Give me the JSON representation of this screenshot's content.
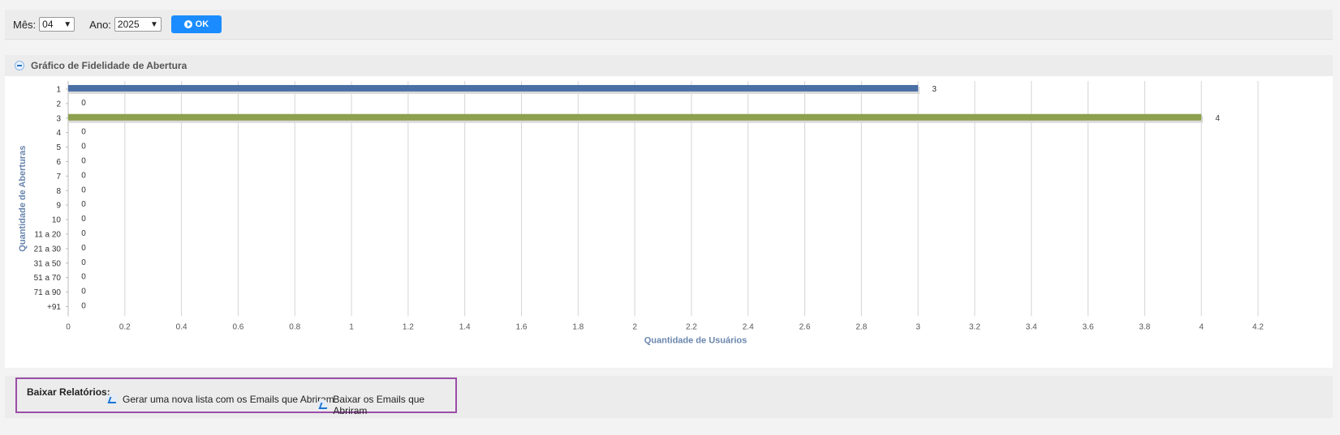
{
  "toolbar": {
    "month_label": "Mês:",
    "month_value": "04",
    "year_label": "Ano:",
    "year_value": "2025",
    "ok_label": "OK"
  },
  "panel": {
    "title": "Gráfico de Fidelidade de Abertura"
  },
  "chart_data": {
    "type": "bar",
    "orientation": "horizontal",
    "categories": [
      "1",
      "2",
      "3",
      "4",
      "5",
      "6",
      "7",
      "8",
      "9",
      "10",
      "11 a 20",
      "21 a 30",
      "31 a 50",
      "51 a 70",
      "71 a 90",
      "+91"
    ],
    "values": [
      3,
      0,
      4,
      0,
      0,
      0,
      0,
      0,
      0,
      0,
      0,
      0,
      0,
      0,
      0,
      0
    ],
    "bar_colors": [
      "#4a6fa5",
      "#4a6fa5",
      "#8ca04e",
      "#4a6fa5",
      "#4a6fa5",
      "#4a6fa5",
      "#4a6fa5",
      "#4a6fa5",
      "#4a6fa5",
      "#4a6fa5",
      "#4a6fa5",
      "#4a6fa5",
      "#4a6fa5",
      "#4a6fa5",
      "#4a6fa5",
      "#4a6fa5"
    ],
    "xlabel": "Quantidade de Usuários",
    "ylabel": "Quantidade de Aberturas",
    "xlim": [
      0,
      4.2
    ],
    "xticks": [
      "0",
      "0.2",
      "0.4",
      "0.6",
      "0.8",
      "1",
      "1.2",
      "1.4",
      "1.6",
      "1.8",
      "2",
      "2.2",
      "2.4",
      "2.6",
      "2.8",
      "3",
      "3.2",
      "3.4",
      "3.6",
      "3.8",
      "4",
      "4.2"
    ],
    "grid": true,
    "legend": "none"
  },
  "footer": {
    "title": "Baixar Relatórios:",
    "link1": "Gerar uma nova lista com os Emails que Abriram",
    "link2": "Baixar os Emails que Abriram"
  }
}
